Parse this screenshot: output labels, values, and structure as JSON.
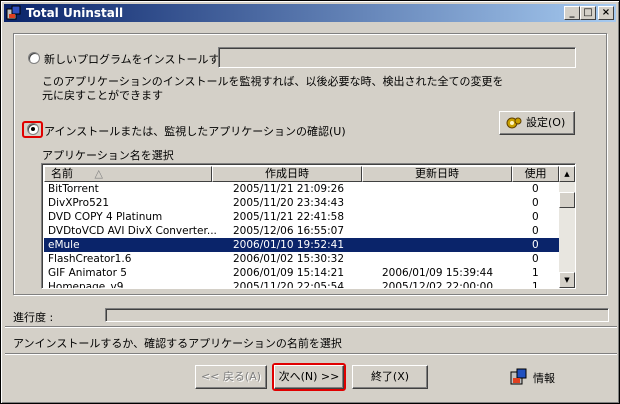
{
  "window": {
    "title": "Total Uninstall"
  },
  "options": {
    "install_label": "新しいプログラムをインストールする(I)",
    "install_path": "",
    "install_desc_line1": "このアプリケーションのインストールを監視すれば、以後必要な時、検出された全ての変更を",
    "install_desc_line2": "元に戻すことができます",
    "verify_label": "アインストールまたは、監視したアプリケーションの確認(U)",
    "settings_label": "設定(O)"
  },
  "app_list": {
    "caption": "アプリケーション名を選択",
    "columns": {
      "name": "名前",
      "sort_indicator": "△",
      "created": "作成日時",
      "updated": "更新日時",
      "usage": "使用"
    },
    "rows": [
      {
        "name": "BitTorrent",
        "created": "2005/11/21 21:09:26",
        "updated": "",
        "usage": "0"
      },
      {
        "name": "DivXPro521",
        "created": "2005/11/20 23:34:43",
        "updated": "",
        "usage": "0"
      },
      {
        "name": "DVD COPY 4 Platinum",
        "created": "2005/11/21 22:41:58",
        "updated": "",
        "usage": "0"
      },
      {
        "name": "DVDtoVCD AVI DivX Converter...",
        "created": "2005/12/06 16:55:07",
        "updated": "",
        "usage": "0"
      },
      {
        "name": "eMule",
        "created": "2006/01/10 19:52:41",
        "updated": "",
        "usage": "0"
      },
      {
        "name": "FlashCreator1.6",
        "created": "2006/01/02 15:30:32",
        "updated": "",
        "usage": "0"
      },
      {
        "name": "GIF Animator 5",
        "created": "2006/01/09 15:14:21",
        "updated": "2006/01/09 15:39:44",
        "usage": "1"
      },
      {
        "name": "Homepage_v9",
        "created": "2005/11/20 22:05:54",
        "updated": "2005/12/02 22:00:00",
        "usage": "1"
      }
    ],
    "selected_index": 4
  },
  "progress": {
    "label": "進行度 :",
    "value": 0
  },
  "status": {
    "text": "アンインストールするか、確認するアプリケーションの名前を選択"
  },
  "buttons": {
    "back": "<< 戻る(A)",
    "next": "次へ(N) >>",
    "finish": "終了(X)",
    "info": "情報"
  },
  "colors": {
    "highlight_red": "#e00000",
    "selection": "#0a246a",
    "titlebar": "#0a246a"
  }
}
